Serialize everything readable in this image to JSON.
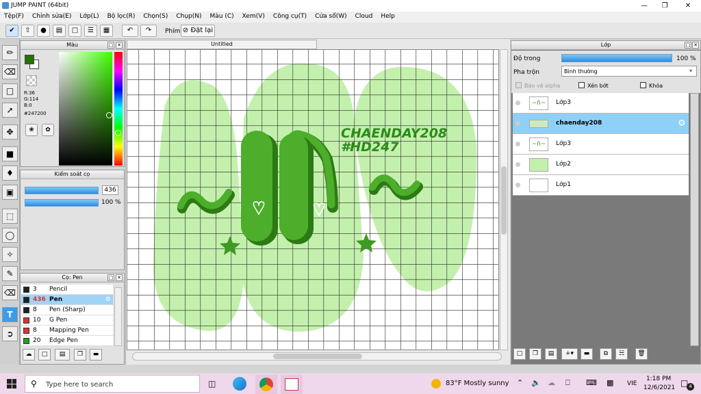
{
  "app": {
    "title": "JUMP PAINT (64bit)"
  },
  "menu": [
    "Tệp(F)",
    "Chỉnh sửa(E)",
    "Lớp(L)",
    "Bộ lọc(R)",
    "Chọn(S)",
    "Chụp(N)",
    "Màu (C)",
    "Xem(V)",
    "Công cụ(T)",
    "Cửa sổ(W)",
    "Cloud",
    "Help"
  ],
  "toolbar": {
    "phim_label": "Phím",
    "reset_label": "Đặt lại"
  },
  "color_panel": {
    "title": "Màu",
    "r": "R:36",
    "g": "G:114",
    "b": "B:0",
    "hex": "#247200",
    "current_color": "#247200"
  },
  "brush_control": {
    "title": "Kiểm soát cọ",
    "size": "436",
    "opacity": "100 %"
  },
  "brush_panel": {
    "title": "Cọ: Pen",
    "items": [
      {
        "size": "3",
        "name": "Pencil",
        "color": "#222222"
      },
      {
        "size": "436",
        "name": "Pen",
        "color": "#222222"
      },
      {
        "size": "8",
        "name": "Pen (Sharp)",
        "color": "#222222"
      },
      {
        "size": "10",
        "name": "G Pen",
        "color": "#e03030"
      },
      {
        "size": "8",
        "name": "Mapping Pen",
        "color": "#e03030"
      },
      {
        "size": "20",
        "name": "Edge Pen",
        "color": "#20a020"
      }
    ]
  },
  "canvas": {
    "tab_title": "Untitled",
    "text_line1": "CHAENDAY208",
    "text_line2": "#HD247"
  },
  "layer_panel": {
    "title": "Lớp",
    "opacity_label": "Độ trong",
    "opacity_value": "100 %",
    "blend_label": "Pha trộn",
    "blend_value": "Bình thường",
    "protect_alpha": "Bảo vệ alpha",
    "clip": "Xén bớt",
    "lock": "Khóa",
    "layers": [
      {
        "name": "Lớp3"
      },
      {
        "name": "chaenday208"
      },
      {
        "name": "Lớp3"
      },
      {
        "name": "Lớp2"
      },
      {
        "name": "Lớp1"
      }
    ]
  },
  "taskbar": {
    "search_placeholder": "Type here to search",
    "weather": "83°F  Mostly sunny",
    "lang": "VIE",
    "time": "1:18 PM",
    "date": "12/6/2021",
    "notif_count": "4"
  }
}
